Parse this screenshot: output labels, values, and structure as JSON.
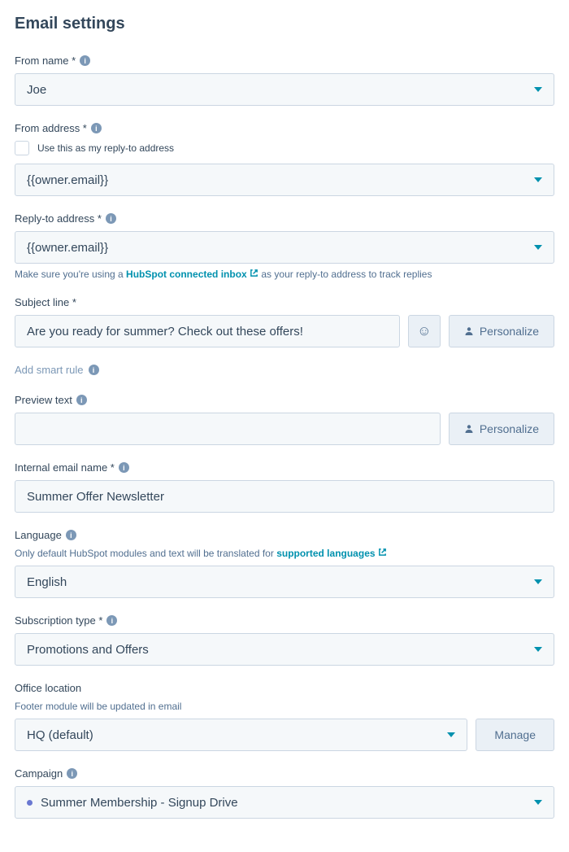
{
  "page_title": "Email settings",
  "from_name": {
    "label": "From name *",
    "value": "Joe"
  },
  "from_address": {
    "label": "From address *",
    "checkbox_label": "Use this as my reply-to address",
    "value": "{{owner.email}}"
  },
  "reply_to": {
    "label": "Reply-to address *",
    "value": "{{owner.email}}",
    "helper_prefix": "Make sure you're using a ",
    "helper_link": "HubSpot connected inbox",
    "helper_suffix": "  as your reply-to address to track replies"
  },
  "subject": {
    "label": "Subject line *",
    "value": "Are you ready for summer? Check out these offers!",
    "personalize_label": "Personalize"
  },
  "smart_rule": {
    "label": "Add smart rule"
  },
  "preview": {
    "label": "Preview text",
    "value": "",
    "personalize_label": "Personalize"
  },
  "internal_name": {
    "label": "Internal email name *",
    "value": "Summer Offer Newsletter"
  },
  "language": {
    "label": "Language",
    "helper_prefix": "Only default HubSpot modules and text will be translated for ",
    "helper_link": "supported languages",
    "value": "English"
  },
  "subscription": {
    "label": "Subscription type *",
    "value": "Promotions and Offers"
  },
  "office": {
    "label": "Office location",
    "helper": "Footer module will be updated in email",
    "value": "HQ (default)",
    "manage_label": "Manage"
  },
  "campaign": {
    "label": "Campaign",
    "value": "Summer Membership - Signup Drive"
  }
}
